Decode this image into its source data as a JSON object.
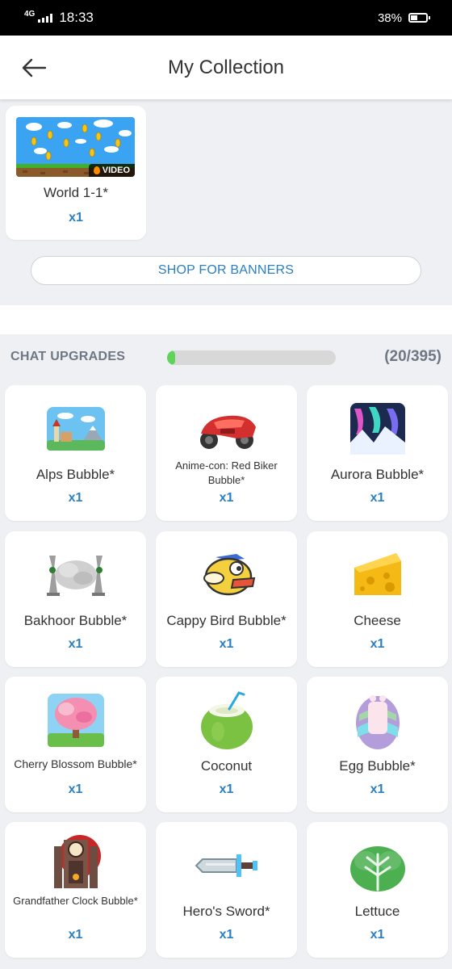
{
  "status": {
    "network": "4G",
    "time": "18:33",
    "battery": "38%"
  },
  "header": {
    "title": "My Collection"
  },
  "banner": {
    "name": "World 1-1*",
    "qty": "x1",
    "badge": "VIDEO"
  },
  "shop": {
    "label": "SHOP FOR BANNERS"
  },
  "upgrades": {
    "label": "CHAT UPGRADES",
    "count": "(20/395)",
    "progress_fraction": 0.05
  },
  "items": [
    {
      "name": "Alps Bubble*",
      "qty": "x1",
      "icon": "alps-icon"
    },
    {
      "name": "Anime-con: Red Biker Bubble*",
      "qty": "x1",
      "icon": "red-biker-icon"
    },
    {
      "name": "Aurora Bubble*",
      "qty": "x1",
      "icon": "aurora-icon"
    },
    {
      "name": "Bakhoor Bubble*",
      "qty": "x1",
      "icon": "bakhoor-icon"
    },
    {
      "name": "Cappy Bird Bubble*",
      "qty": "x1",
      "icon": "cappy-bird-icon"
    },
    {
      "name": "Cheese",
      "qty": "x1",
      "icon": "cheese-icon"
    },
    {
      "name": "Cherry Blossom Bubble*",
      "qty": "x1",
      "icon": "cherry-blossom-icon"
    },
    {
      "name": "Coconut",
      "qty": "x1",
      "icon": "coconut-icon"
    },
    {
      "name": "Egg Bubble*",
      "qty": "x1",
      "icon": "egg-icon"
    },
    {
      "name": "Grandfather Clock Bubble*",
      "qty": "x1",
      "icon": "grandfather-clock-icon"
    },
    {
      "name": "Hero's Sword*",
      "qty": "x1",
      "icon": "sword-icon"
    },
    {
      "name": "Lettuce",
      "qty": "x1",
      "icon": "lettuce-icon"
    }
  ]
}
